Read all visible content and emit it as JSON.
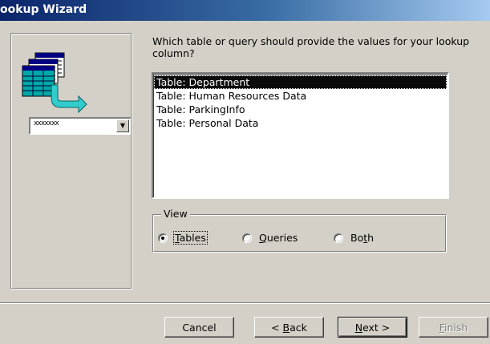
{
  "window": {
    "title": "ookup Wizard"
  },
  "illustration": {
    "combo_text": "xxxxxxx",
    "combo_arrow": "▼"
  },
  "question": "Which table or query should provide the values for your lookup column?",
  "list": {
    "items": [
      "Table: Department",
      "Table: Human Resources Data",
      "Table: ParkingInfo",
      "Table: Personal Data"
    ],
    "selected_index": 0
  },
  "view": {
    "legend": "View",
    "options": [
      {
        "pre": "",
        "accel": "T",
        "post": "ables",
        "checked": true
      },
      {
        "pre": "",
        "accel": "Q",
        "post": "ueries",
        "checked": false
      },
      {
        "pre": "Bo",
        "accel": "t",
        "post": "h",
        "checked": false
      }
    ]
  },
  "buttons": {
    "cancel": {
      "pre": "Cancel",
      "accel": "",
      "post": ""
    },
    "back": {
      "pre": "< ",
      "accel": "B",
      "post": "ack"
    },
    "next": {
      "pre": "",
      "accel": "N",
      "post": "ext >"
    },
    "finish": {
      "pre": "",
      "accel": "F",
      "post": "inish"
    }
  },
  "colors": {
    "title_gradient_start": "#0a246a",
    "title_gradient_end": "#a6caf0",
    "face": "#d4d0c8",
    "selection": "#0a0a0a"
  },
  "icons": {
    "wizard_illustration": "table-to-combo-arrow-icon"
  }
}
